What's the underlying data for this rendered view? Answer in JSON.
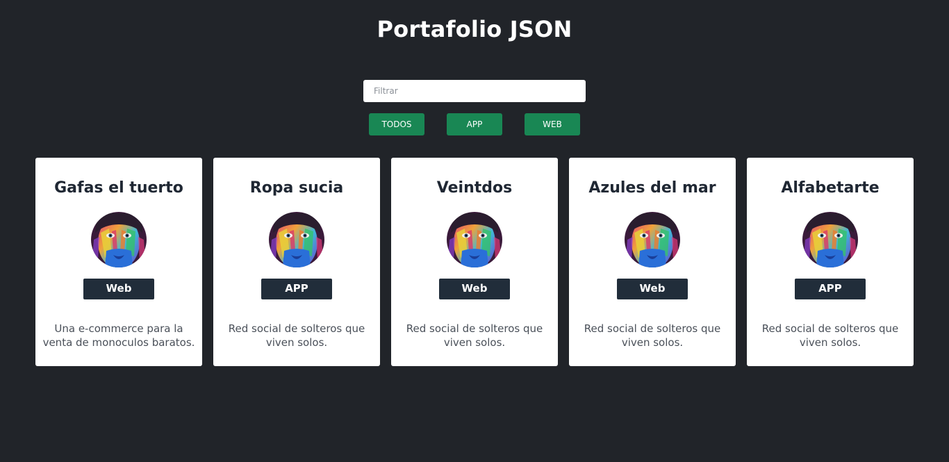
{
  "header": {
    "title": "Portafolio JSON"
  },
  "filter": {
    "placeholder": "Filtrar",
    "value": ""
  },
  "buttons": [
    {
      "label": "TODOS"
    },
    {
      "label": "APP"
    },
    {
      "label": "WEB"
    }
  ],
  "colors": {
    "background": "#212429",
    "button": "#198754",
    "badge": "#212d3a",
    "card": "#ffffff"
  },
  "projects": [
    {
      "title": "Gafas el tuerto",
      "type": "Web",
      "description": "Una e-commerce para la venta de monoculos baratos.",
      "image": "colorful-painted-face"
    },
    {
      "title": "Ropa sucia",
      "type": "APP",
      "description": "Red social de solteros que viven solos.",
      "image": "colorful-painted-face"
    },
    {
      "title": "Veintdos",
      "type": "Web",
      "description": "Red social de solteros que viven solos.",
      "image": "colorful-painted-face"
    },
    {
      "title": "Azules del mar",
      "type": "Web",
      "description": "Red social de solteros que viven solos.",
      "image": "colorful-painted-face"
    },
    {
      "title": "Alfabetarte",
      "type": "APP",
      "description": "Red social de solteros que viven solos.",
      "image": "colorful-painted-face"
    }
  ]
}
